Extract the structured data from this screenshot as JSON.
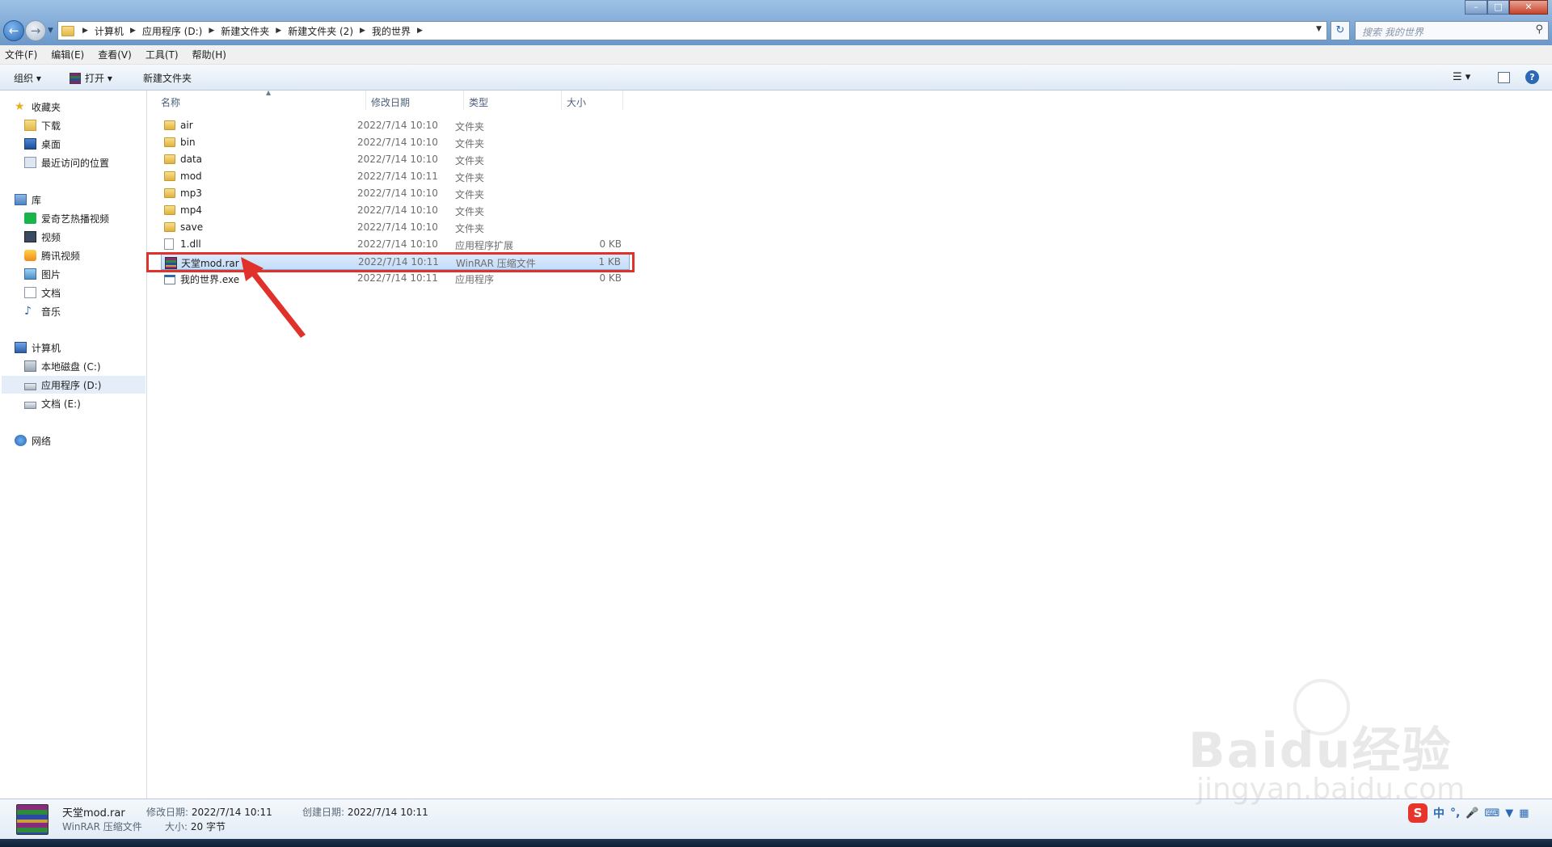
{
  "window": {
    "minimize": "–",
    "maximize": "□",
    "close": "✕"
  },
  "address": {
    "crumbs": [
      "计算机",
      "应用程序 (D:)",
      "新建文件夹",
      "新建文件夹 (2)",
      "我的世界"
    ],
    "search_placeholder": "搜索 我的世界"
  },
  "menu": [
    "文件(F)",
    "编辑(E)",
    "查看(V)",
    "工具(T)",
    "帮助(H)"
  ],
  "toolbar": {
    "organize": "组织 ▾",
    "open": "打开 ▾",
    "new_folder": "新建文件夹"
  },
  "sidebar": {
    "favorites": {
      "header": "收藏夹",
      "items": [
        "下载",
        "桌面",
        "最近访问的位置"
      ]
    },
    "libraries": {
      "header": "库",
      "items": [
        "爱奇艺热播视频",
        "视频",
        "腾讯视频",
        "图片",
        "文档",
        "音乐"
      ]
    },
    "computer": {
      "header": "计算机",
      "items": [
        "本地磁盘 (C:)",
        "应用程序 (D:)",
        "文档 (E:)"
      ],
      "selected_index": 1
    },
    "network": {
      "header": "网络"
    }
  },
  "columns": {
    "name": "名称",
    "date": "修改日期",
    "type": "类型",
    "size": "大小"
  },
  "files": [
    {
      "name": "air",
      "date": "2022/7/14 10:10",
      "type": "文件夹",
      "size": "",
      "icon": "folder-icon"
    },
    {
      "name": "bin",
      "date": "2022/7/14 10:10",
      "type": "文件夹",
      "size": "",
      "icon": "folder-icon"
    },
    {
      "name": "data",
      "date": "2022/7/14 10:10",
      "type": "文件夹",
      "size": "",
      "icon": "folder-icon"
    },
    {
      "name": "mod",
      "date": "2022/7/14 10:11",
      "type": "文件夹",
      "size": "",
      "icon": "folder-icon"
    },
    {
      "name": "mp3",
      "date": "2022/7/14 10:10",
      "type": "文件夹",
      "size": "",
      "icon": "folder-icon"
    },
    {
      "name": "mp4",
      "date": "2022/7/14 10:10",
      "type": "文件夹",
      "size": "",
      "icon": "folder-icon"
    },
    {
      "name": "save",
      "date": "2022/7/14 10:10",
      "type": "文件夹",
      "size": "",
      "icon": "folder-icon"
    },
    {
      "name": "1.dll",
      "date": "2022/7/14 10:10",
      "type": "应用程序扩展",
      "size": "0 KB",
      "icon": "dll-icon"
    },
    {
      "name": "天堂mod.rar",
      "date": "2022/7/14 10:11",
      "type": "WinRAR 压缩文件",
      "size": "1 KB",
      "icon": "rar-icon",
      "selected": true
    },
    {
      "name": "我的世界.exe",
      "date": "2022/7/14 10:11",
      "type": "应用程序",
      "size": "0 KB",
      "icon": "exe-icon"
    }
  ],
  "details": {
    "name": "天堂mod.rar",
    "type": "WinRAR 压缩文件",
    "modified_label": "修改日期:",
    "modified": "2022/7/14 10:11",
    "created_label": "创建日期:",
    "created": "2022/7/14 10:11",
    "size_label": "大小:",
    "size": "20 字节"
  },
  "ime": {
    "logo": "S",
    "lang": "中",
    "punct": "°,",
    "icons": [
      "microphone-icon",
      "keyboard-icon",
      "shirt-icon",
      "grid-icon"
    ]
  },
  "watermark": {
    "main": "Baidu经验",
    "sub": "jingyan.baidu.com"
  },
  "colors": {
    "highlight": "#e0312b",
    "selection": "#c4ddf8",
    "accent": "#2b69b5"
  }
}
